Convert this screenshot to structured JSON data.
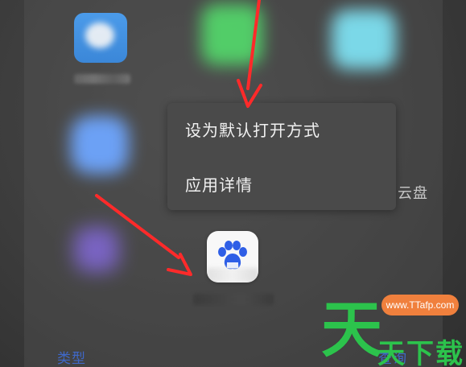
{
  "context_menu": {
    "items": [
      {
        "label": "设为默认打开方式"
      },
      {
        "label": "应用详情"
      }
    ]
  },
  "background": {
    "side_text": "云盘",
    "bottom_left": "类型",
    "bottom_right": "查询"
  },
  "watermark": {
    "big": "天",
    "pill": "www.TTafp.com",
    "small": "天下载"
  },
  "colors": {
    "arrow_red": "#ff2a2a",
    "menu_bg": "#4a4a4a",
    "menu_text": "#f1f1f1",
    "watermark_green": "#2cc34c",
    "watermark_orange": "#f0803d",
    "link_blue": "#3f68c9"
  }
}
